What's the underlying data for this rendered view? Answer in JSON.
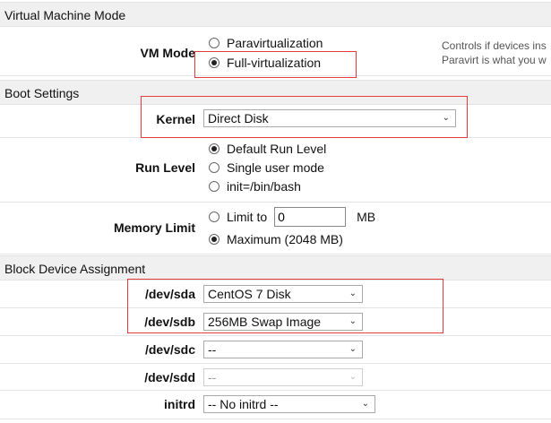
{
  "vm_mode_section": {
    "title": "Virtual Machine Mode",
    "vm_mode": {
      "label": "VM Mode",
      "options": [
        "Paravirtualization",
        "Full-virtualization"
      ],
      "selected": "Full-virtualization",
      "help_line1": "Controls if devices ins",
      "help_line2": "Paravirt is what you w"
    }
  },
  "boot_section": {
    "title": "Boot Settings",
    "kernel": {
      "label": "Kernel",
      "value": "Direct Disk"
    },
    "run_level": {
      "label": "Run Level",
      "options": [
        "Default Run Level",
        "Single user mode",
        "init=/bin/bash"
      ],
      "selected": "Default Run Level"
    },
    "memory_limit": {
      "label": "Memory Limit",
      "limit_option": "Limit to",
      "limit_value": "0",
      "limit_unit": "MB",
      "maximum_option": "Maximum (2048 MB)",
      "selected": "Maximum (2048 MB)"
    }
  },
  "block_section": {
    "title": "Block Device Assignment",
    "devices": [
      {
        "label": "/dev/sda",
        "value": "CentOS 7 Disk",
        "disabled": false
      },
      {
        "label": "/dev/sdb",
        "value": "256MB Swap Image",
        "disabled": false
      },
      {
        "label": "/dev/sdc",
        "value": "--",
        "disabled": false
      },
      {
        "label": "/dev/sdd",
        "value": "--",
        "disabled": true
      }
    ],
    "initrd": {
      "label": "initrd",
      "value": "-- No initrd --"
    }
  },
  "icons": {
    "dropdown": "chevron-down-icon",
    "radio_checked": "radio-checked-icon",
    "radio_unchecked": "radio-unchecked-icon"
  },
  "colors": {
    "highlight_border": "#e53b3b",
    "section_header_bg": "#f0f0f0"
  }
}
